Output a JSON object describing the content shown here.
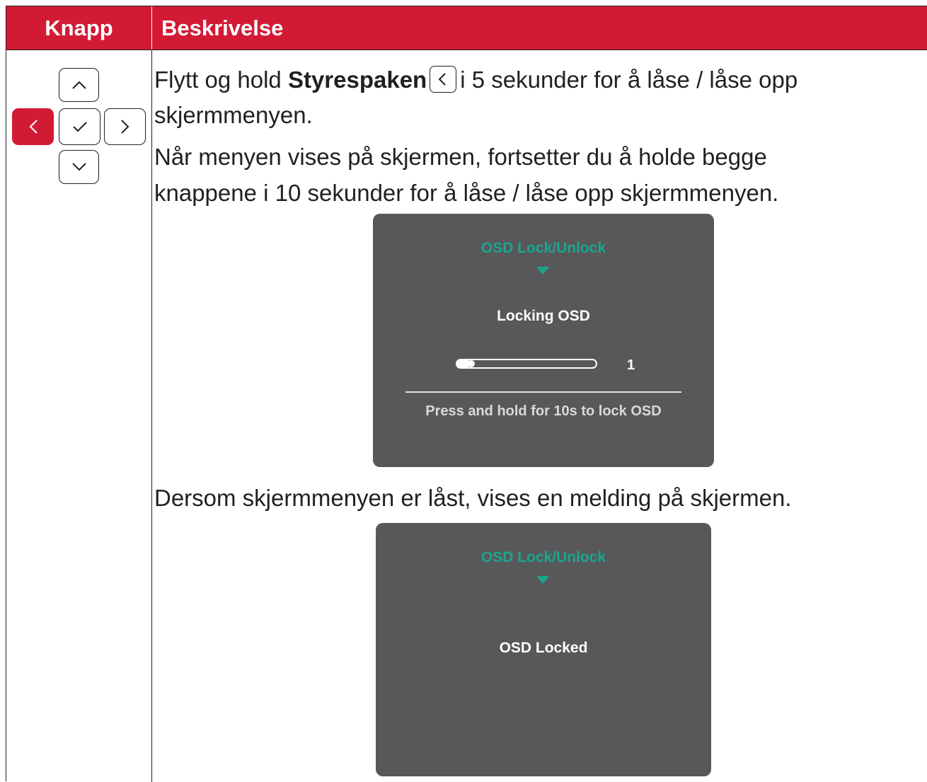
{
  "table": {
    "header": {
      "col1": "Knapp",
      "col2": "Beskrivelse"
    }
  },
  "joystick": {
    "up_icon": "chevron-up-icon",
    "left_icon": "chevron-left-icon",
    "center_icon": "check-icon",
    "right_icon": "chevron-right-icon",
    "down_icon": "chevron-down-icon",
    "active_button": "left",
    "active_color": "#d31a35"
  },
  "description": {
    "p1_prefix": "Flytt og hold ",
    "p1_bold": "Styrespaken",
    "p1_suffix": "i 5 sekunder for å låse / låse opp",
    "p1_line2": "skjermmenyen.",
    "p2_line1": "Når menyen vises på skjermen, fortsetter du å holde begge",
    "p2_line2": "knappene i 10 sekunder for å låse / låse opp skjermmenyen.",
    "p3": "Dersom skjermmenyen er låst, vises en melding på skjermen."
  },
  "osd_locking": {
    "title": "OSD Lock/Unlock",
    "message": "Locking OSD",
    "progress_fraction": 0.1,
    "count": "1",
    "hint": "Press and hold for 10s to lock OSD"
  },
  "osd_locked": {
    "title": "OSD Lock/Unlock",
    "message": "OSD Locked"
  },
  "colors": {
    "header_bg": "#d31a35",
    "osd_bg": "#58585a",
    "osd_accent": "#1aa58e"
  }
}
